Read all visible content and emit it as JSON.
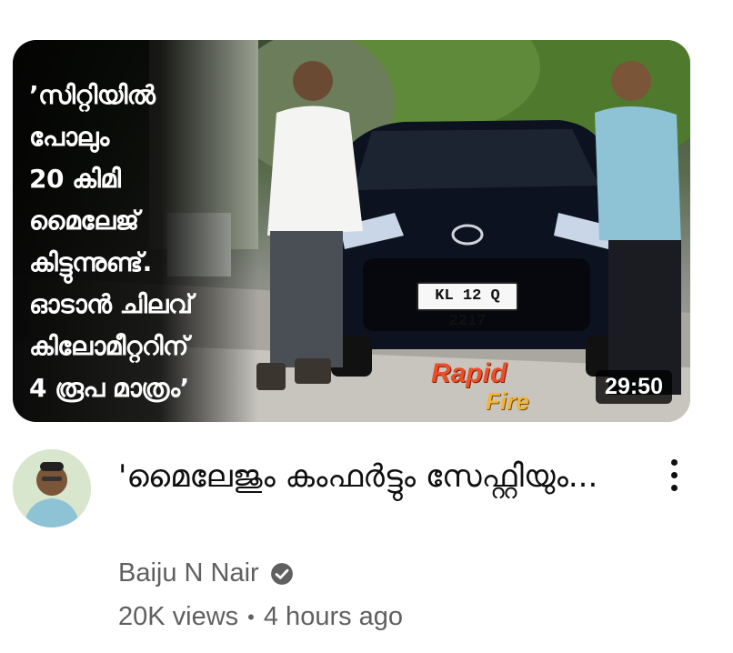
{
  "video": {
    "thumbnail": {
      "overlay_text": "’സിറ്റിയിൽ\nപോലും\n20 കിമി\nമൈലേജ്\nകിട്ടുന്നുണ്ട്.\nഓടാൻ ചിലവ്\nകിലോമീറ്ററിന്\n4 രൂപ മാത്രം’",
      "license_plate": "KL 12 Q 2217",
      "watermark_top": "Rapid",
      "watermark_bottom": "Fire",
      "duration": "29:50"
    },
    "title": "'മൈലേജും കംഫർട്ടും സേഫ്റ്റിയും...",
    "channel_name": "Baiju N Nair",
    "views": "20K views",
    "separator": "•",
    "age": "4 hours ago"
  },
  "colors": {
    "title": "#0f0f0f",
    "meta": "#606060",
    "duration_bg": "#000000",
    "rapid": "#e8502a",
    "fire": "#f2b53a"
  },
  "icons": {
    "verified": "verified-check-icon",
    "menu": "more-vertical-icon"
  }
}
